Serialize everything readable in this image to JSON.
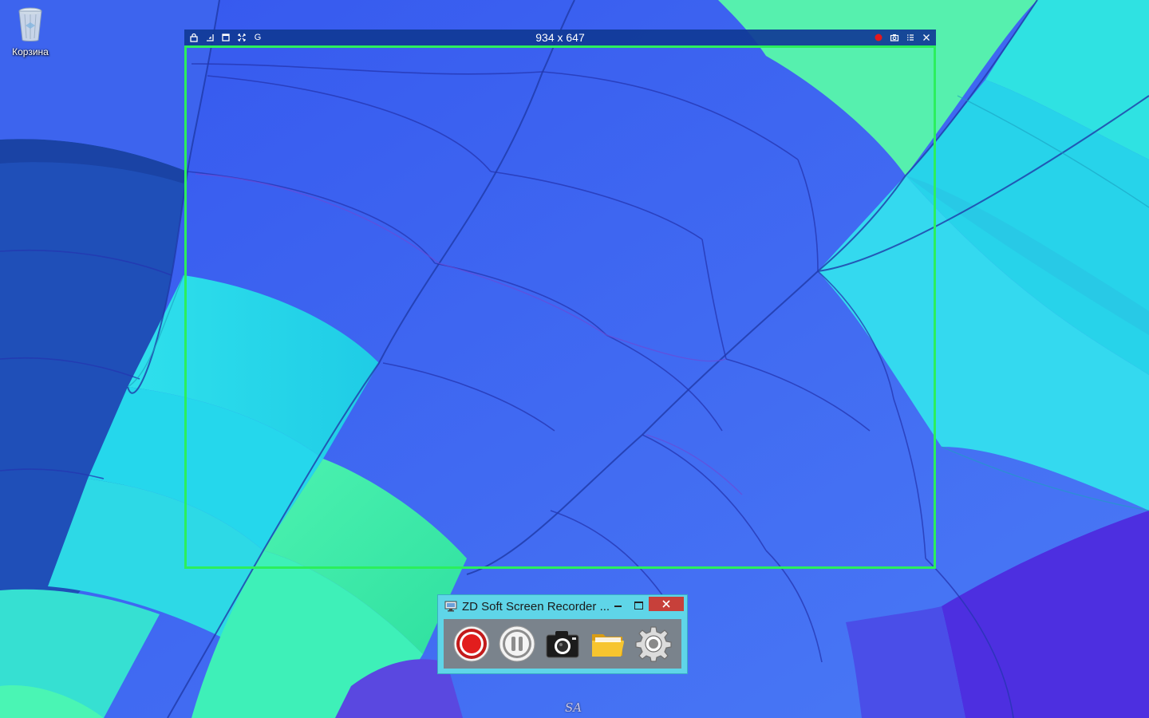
{
  "desktop": {
    "recycle_bin_label": "Корзина",
    "recycle_bin_icon": "recycle-bin-icon"
  },
  "capture": {
    "size_text": "934 x 647",
    "left_tools": [
      {
        "icon": "lock-icon"
      },
      {
        "icon": "resize-corner-icon"
      },
      {
        "icon": "window-icon"
      },
      {
        "icon": "fullscreen-icon"
      },
      {
        "icon": "g-letter-icon",
        "text": "G"
      }
    ],
    "right_tools": [
      {
        "icon": "record-dot-icon",
        "color": "#e4181d"
      },
      {
        "icon": "camera-icon"
      },
      {
        "icon": "list-icon"
      },
      {
        "icon": "close-icon"
      }
    ],
    "frame_color": "#2bef5c"
  },
  "recorder": {
    "title": "ZD Soft Screen Recorder ...",
    "buttons": [
      {
        "icon": "record-icon"
      },
      {
        "icon": "pause-icon"
      },
      {
        "icon": "camera-icon"
      },
      {
        "icon": "folder-icon"
      },
      {
        "icon": "settings-gear-icon"
      }
    ],
    "close_color": "#c7403a"
  },
  "watermark": "SA"
}
